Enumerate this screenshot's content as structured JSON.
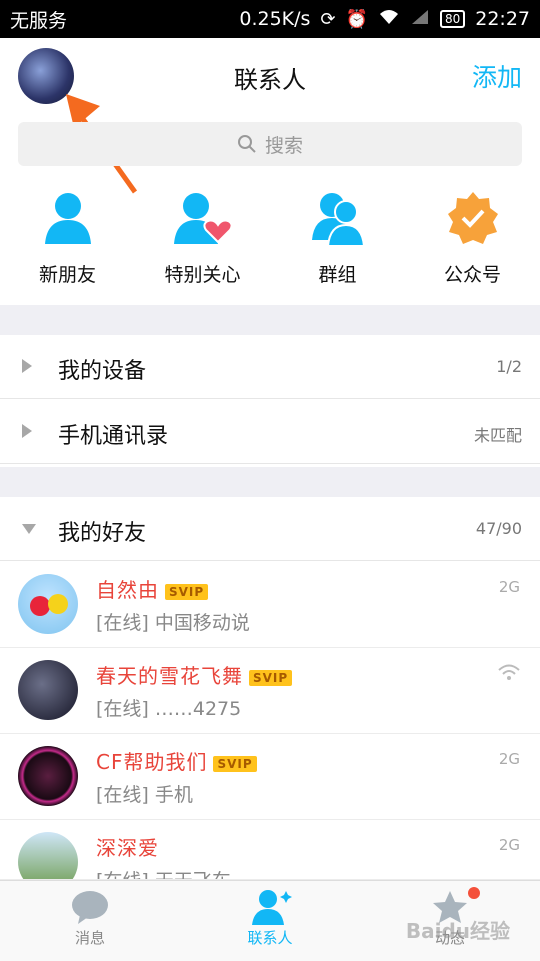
{
  "status_bar": {
    "carrier": "无服务",
    "speed": "0.25K/s",
    "battery": "80",
    "time": "22:27"
  },
  "header": {
    "title": "联系人",
    "add_label": "添加"
  },
  "search": {
    "placeholder": "搜索"
  },
  "quick_actions": [
    {
      "label": "新朋友",
      "icon": "person-icon"
    },
    {
      "label": "特别关心",
      "icon": "person-heart-icon"
    },
    {
      "label": "群组",
      "icon": "group-icon"
    },
    {
      "label": "公众号",
      "icon": "verified-badge-icon"
    }
  ],
  "sections": [
    {
      "name": "我的设备",
      "count": "1/2",
      "expanded": false
    },
    {
      "name": "手机通讯录",
      "count": "未匹配",
      "expanded": false
    },
    {
      "name": "我的好友",
      "count": "47/90",
      "expanded": true
    }
  ],
  "friends": [
    {
      "name": "自然由",
      "badge": "SVIP",
      "status": "[在线] 中国移动说",
      "net": "2G"
    },
    {
      "name": "春天的雪花飞舞",
      "badge": "SVIP",
      "status": "[在线] ……4275",
      "net": "wifi"
    },
    {
      "name": "CF帮助我们",
      "badge": "SVIP",
      "status": "[在线] 手机",
      "net": "2G"
    },
    {
      "name": "深深爱",
      "badge": "",
      "status": "[在线] 天天飞车",
      "net": "2G"
    }
  ],
  "tabs": [
    {
      "label": "消息",
      "icon": "chat-bubble-icon",
      "active": false
    },
    {
      "label": "联系人",
      "icon": "contacts-icon",
      "active": true
    },
    {
      "label": "动态",
      "icon": "star-icon",
      "active": false
    }
  ],
  "watermark": "Baidu经验",
  "colors": {
    "accent": "#12b7f5",
    "name_red": "#e8443a",
    "svip": "#ffc21c",
    "orange_arrow": "#f46a1f"
  }
}
